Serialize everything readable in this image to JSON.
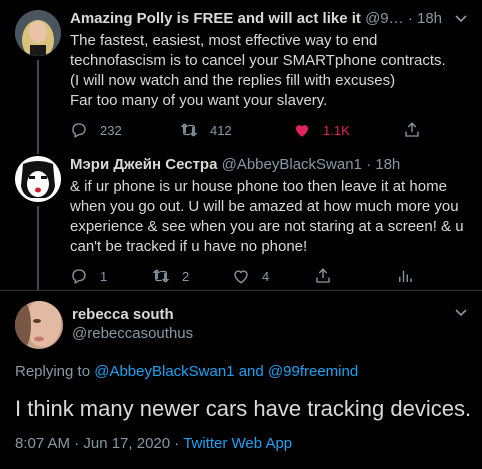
{
  "tweet1": {
    "name": "Amazing Polly is FREE and will act like it",
    "handle": "@9…",
    "time": "18h",
    "lines": [
      "The fastest, easiest, most effective way to end",
      "technofascism is to cancel your SMARTphone contracts.",
      "(I will now watch and the replies fill with excuses)",
      "Far too many of you want your slavery."
    ],
    "replies": "232",
    "retweets": "412",
    "likes": "1.1K",
    "like_color": "#e0245e"
  },
  "tweet2": {
    "name": "Мэри Джейн Сестра",
    "handle": "@AbbeyBlackSwan1",
    "time": "18h",
    "lines": [
      "& if ur phone is ur house phone too then leave it at home",
      "when you go out. U will be amazed at how much more you",
      "experience & see when you are not staring at a screen! & u",
      "can't be tracked if u have no phone!"
    ],
    "replies": "1",
    "retweets": "2",
    "likes": "4"
  },
  "main": {
    "name": "rebecca south",
    "handle": "@rebeccasouthus",
    "replying_prefix": "Replying to",
    "mention1": "@AbbeyBlackSwan1",
    "and": "and",
    "mention2": "@99freemind",
    "text": "I think many newer cars have tracking devices.",
    "timestamp": "8:07 AM · Jun 17, 2020 ·",
    "source": "Twitter Web App"
  },
  "separator": "·",
  "colors": {
    "link": "#1da1f2",
    "muted": "#8899a6"
  }
}
